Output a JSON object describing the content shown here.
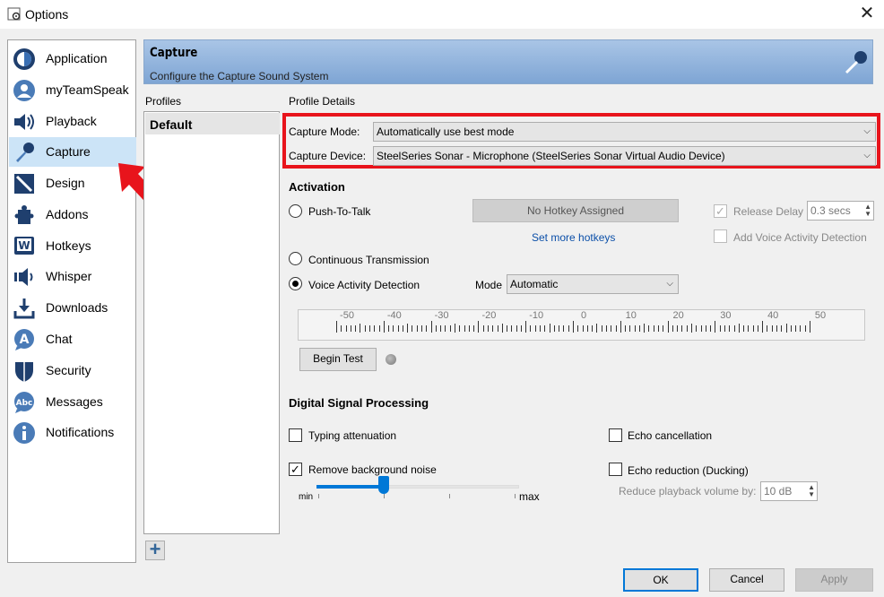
{
  "window": {
    "title": "Options",
    "close_glyph": "✕"
  },
  "sidebar": {
    "items": [
      {
        "label": "Application",
        "icon": "application-icon"
      },
      {
        "label": "myTeamSpeak",
        "icon": "user-icon"
      },
      {
        "label": "Playback",
        "icon": "speaker-icon"
      },
      {
        "label": "Capture",
        "icon": "microphone-icon",
        "active": true
      },
      {
        "label": "Design",
        "icon": "design-icon"
      },
      {
        "label": "Addons",
        "icon": "puzzle-icon"
      },
      {
        "label": "Hotkeys",
        "icon": "keyboard-icon"
      },
      {
        "label": "Whisper",
        "icon": "whisper-icon"
      },
      {
        "label": "Downloads",
        "icon": "download-icon"
      },
      {
        "label": "Chat",
        "icon": "chat-icon"
      },
      {
        "label": "Security",
        "icon": "shield-icon"
      },
      {
        "label": "Messages",
        "icon": "messages-icon"
      },
      {
        "label": "Notifications",
        "icon": "info-icon"
      }
    ]
  },
  "header": {
    "title": "Capture",
    "subtitle": "Configure the Capture Sound System"
  },
  "profiles": {
    "label": "Profiles",
    "items": [
      "Default"
    ],
    "add_glyph": "+"
  },
  "details": {
    "label": "Profile Details",
    "capture_mode": {
      "label": "Capture Mode:",
      "value": "Automatically use best mode"
    },
    "capture_device": {
      "label": "Capture Device:",
      "value": "SteelSeries Sonar - Microphone (SteelSeries Sonar Virtual Audio Device)"
    },
    "activation": {
      "heading": "Activation",
      "push_to_talk": "Push-To-Talk",
      "hotkey_button": "No Hotkey Assigned",
      "set_more_hotkeys": "Set more hotkeys",
      "release_delay_label": "Release Delay",
      "release_delay_value": "0.3 secs",
      "add_vad": "Add Voice Activity Detection",
      "continuous": "Continuous Transmission",
      "vad": "Voice Activity Detection",
      "selected": "vad",
      "mode_label": "Mode",
      "mode_value": "Automatic",
      "meter_ticks": [
        "-50",
        "-40",
        "-30",
        "-20",
        "-10",
        "0",
        "10",
        "20",
        "30",
        "40",
        "50"
      ],
      "begin_test": "Begin Test"
    },
    "dsp": {
      "heading": "Digital Signal Processing",
      "typing_attenuation": {
        "label": "Typing attenuation",
        "checked": false
      },
      "remove_noise": {
        "label": "Remove background noise",
        "checked": true
      },
      "noise_level": 0.33,
      "slider_min": "min",
      "slider_max": "max",
      "echo_cancellation": {
        "label": "Echo cancellation",
        "checked": false
      },
      "echo_reduction": {
        "label": "Echo reduction (Ducking)",
        "checked": false
      },
      "reduce_volume_label": "Reduce playback volume by:",
      "reduce_volume_value": "10 dB"
    }
  },
  "footer": {
    "ok": "OK",
    "cancel": "Cancel",
    "apply": "Apply"
  },
  "colors": {
    "highlight": "#e8141c",
    "accent": "#0078d7",
    "header": "#7ea5d4"
  }
}
